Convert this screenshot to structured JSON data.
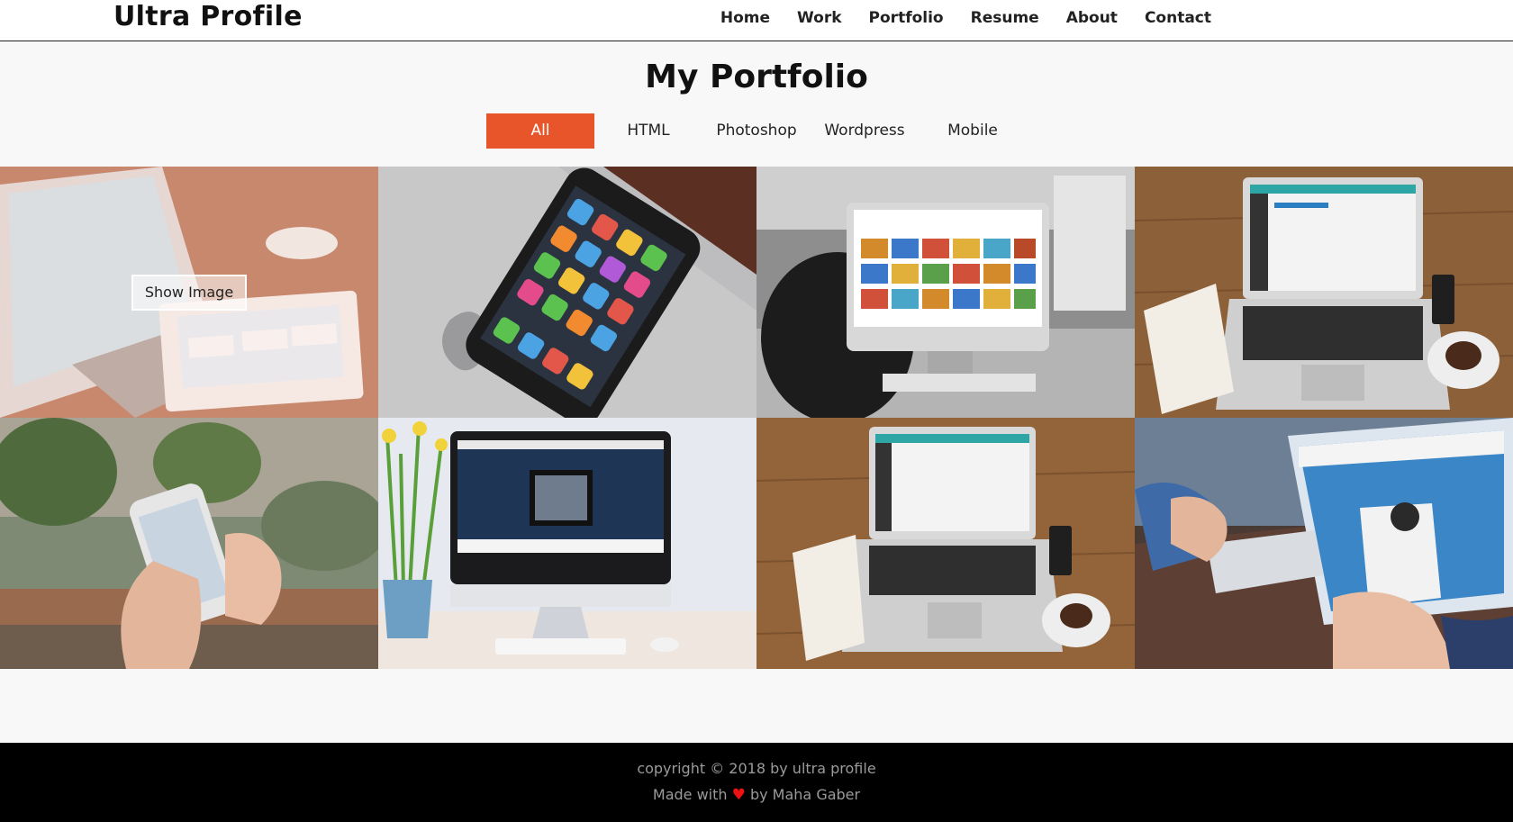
{
  "header": {
    "brand": "Ultra Profile",
    "nav": [
      "Home",
      "Work",
      "Portfolio",
      "Resume",
      "About",
      "Contact"
    ]
  },
  "portfolio": {
    "title": "My Portfolio",
    "filters": [
      "All",
      "HTML",
      "Photoshop",
      "Wordpress",
      "Mobile"
    ],
    "active_filter": "All",
    "show_image_label": "Show Image"
  },
  "footer": {
    "copyright": "copyright © 2018 by ultra profile",
    "made_with_prefix": "Made with",
    "made_with_suffix": "by Maha Gaber",
    "heart_icon": "♥"
  },
  "colors": {
    "accent": "#e9552a",
    "footer_bg": "#000000",
    "heart": "#ee1111"
  }
}
